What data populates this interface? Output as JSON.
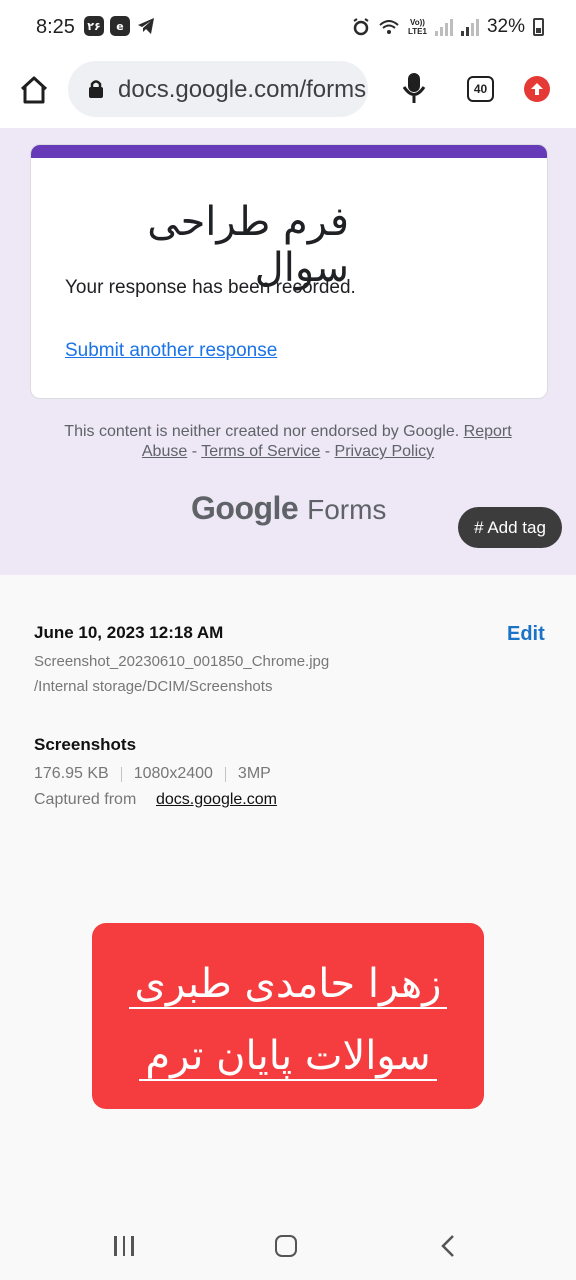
{
  "status_bar": {
    "time": "8:25",
    "notif_badge": "۲۶",
    "battery": "32%",
    "volte_top": "Vo))",
    "volte_bottom": "LTE1"
  },
  "browser": {
    "url": "docs.google.com/forms",
    "tab_count": "40"
  },
  "form": {
    "title": "فرم طراحی سوال",
    "message": "Your response has been recorded.",
    "another_link": "Submit another response"
  },
  "footer": {
    "disclaimer": "This content is neither created nor endorsed by Google.",
    "report_abuse": "Report Abuse",
    "sep": " - ",
    "terms": "Terms of Service",
    "privacy": "Privacy Policy",
    "logo_google": "Google",
    "logo_forms": "Forms"
  },
  "add_tag": "# Add tag",
  "details": {
    "date": "June 10, 2023 12:18 AM",
    "edit": "Edit",
    "filename": "Screenshot_20230610_001850_Chrome.jpg",
    "path": "/Internal storage/DCIM/Screenshots",
    "album": "Screenshots",
    "size": "176.95 KB",
    "resolution": "1080x2400",
    "megapixels": "3MP",
    "captured_label": "Captured from",
    "captured_source": "docs.google.com"
  },
  "banner": {
    "line1": "زهرا حامدی طبری",
    "line2": "سوالات پایان ترم"
  },
  "colors": {
    "form_accent": "#673ab7",
    "page_bg": "#ede7f6",
    "banner": "#f53d3f",
    "link": "#1a73e8",
    "edit": "#1a73c6"
  }
}
